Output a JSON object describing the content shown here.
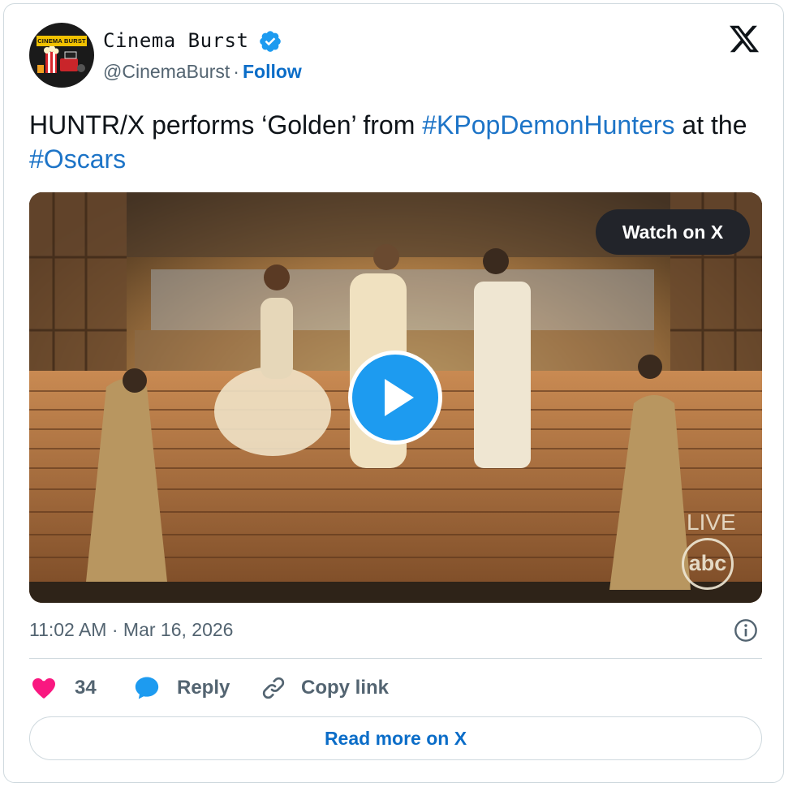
{
  "author": {
    "display_name": "Cinema Burst",
    "handle": "@CinemaBurst",
    "separator": "·",
    "follow_label": "Follow",
    "avatar_text": "CINEMA BURST",
    "verified": true
  },
  "tweet": {
    "text_plain_1": "HUNTR/X performs ‘Golden’ from ",
    "hashtag_1": "#KPopDemonHunters",
    "text_plain_2": " at the ",
    "hashtag_2": "#Oscars"
  },
  "media": {
    "watch_label": "Watch on X",
    "live_label": "LIVE",
    "network_logo": "abc"
  },
  "meta": {
    "timestamp": "11:02 AM · Mar 16, 2026"
  },
  "actions": {
    "like_count": "34",
    "reply_label": "Reply",
    "copy_label": "Copy link"
  },
  "footer": {
    "read_more_label": "Read more on X"
  },
  "icons": {
    "platform": "x-logo-icon",
    "verified": "verified-badge-icon",
    "play": "play-icon",
    "info": "info-icon",
    "like": "heart-icon",
    "reply": "speech-bubble-icon",
    "copy": "link-icon"
  },
  "colors": {
    "link": "#0b6dc8",
    "hashtag": "#1d74c7",
    "heart": "#f91880",
    "reply_blue": "#1d9bf0",
    "muted": "#536471"
  }
}
